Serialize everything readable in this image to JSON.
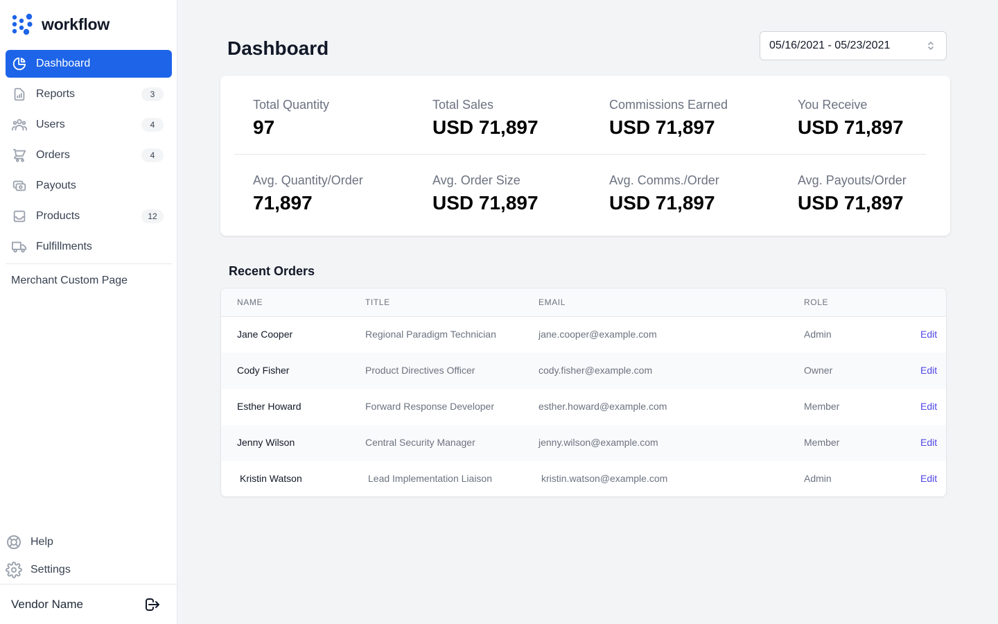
{
  "app": {
    "brand": "workflow"
  },
  "sidebar": {
    "items": [
      {
        "label": "Dashboard",
        "icon": "chart-pie-icon",
        "badge": "",
        "active": true
      },
      {
        "label": "Reports",
        "icon": "document-report-icon",
        "badge": "3",
        "active": false
      },
      {
        "label": "Users",
        "icon": "users-icon",
        "badge": "4",
        "active": false
      },
      {
        "label": "Orders",
        "icon": "shopping-cart-icon",
        "badge": "4",
        "active": false
      },
      {
        "label": "Payouts",
        "icon": "cash-icon",
        "badge": "",
        "active": false
      },
      {
        "label": "Products",
        "icon": "inbox-icon",
        "badge": "12",
        "active": false
      },
      {
        "label": "Fulfillments",
        "icon": "truck-icon",
        "badge": "",
        "active": false
      }
    ],
    "custom_page": "Merchant Custom Page",
    "help_label": "Help",
    "settings_label": "Settings",
    "vendor_name": "Vendor Name"
  },
  "header": {
    "title": "Dashboard",
    "date_range": "05/16/2021 - 05/23/2021"
  },
  "stats": [
    {
      "label": "Total Quantity",
      "value": "97"
    },
    {
      "label": "Total Sales",
      "value": "USD 71,897"
    },
    {
      "label": "Commissions Earned",
      "value": "USD 71,897"
    },
    {
      "label": "You Receive",
      "value": "USD 71,897"
    },
    {
      "label": "Avg. Quantity/Order",
      "value": "71,897"
    },
    {
      "label": "Avg. Order Size",
      "value": "USD 71,897"
    },
    {
      "label": "Avg. Comms./Order",
      "value": "USD 71,897"
    },
    {
      "label": "Avg. Payouts/Order",
      "value": "USD 71,897"
    }
  ],
  "recent_orders": {
    "title": "Recent Orders",
    "columns": [
      "NAME",
      "TITLE",
      "EMAIL",
      "ROLE"
    ],
    "edit_label": "Edit",
    "rows": [
      {
        "name": "Jane Cooper",
        "title": "Regional Paradigm Technician",
        "email": "jane.cooper@example.com",
        "role": "Admin"
      },
      {
        "name": "Cody Fisher",
        "title": "Product Directives Officer",
        "email": "cody.fisher@example.com",
        "role": "Owner"
      },
      {
        "name": "Esther Howard",
        "title": "Forward Response Developer",
        "email": "esther.howard@example.com",
        "role": "Member"
      },
      {
        "name": "Jenny Wilson",
        "title": "Central Security Manager",
        "email": "jenny.wilson@example.com",
        "role": "Member"
      },
      {
        "name": "Kristin Watson",
        "title": "Lead Implementation Liaison",
        "email": "kristin.watson@example.com",
        "role": "Admin"
      }
    ]
  },
  "colors": {
    "accent": "#1d64e8",
    "link": "#4f46e5",
    "background": "#f3f4f6"
  }
}
